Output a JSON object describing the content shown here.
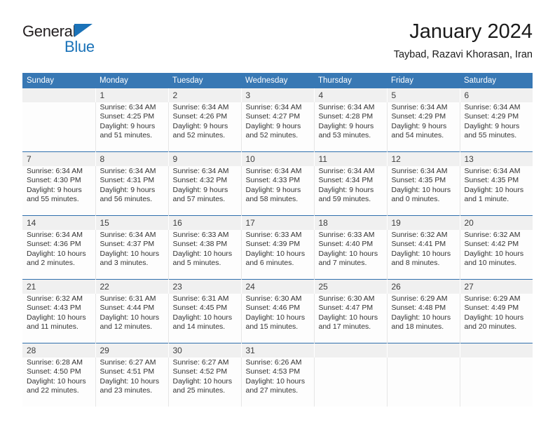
{
  "brand": {
    "name_part1": "General",
    "name_part2": "Blue"
  },
  "header": {
    "title": "January 2024",
    "subtitle": "Taybad, Razavi Khorasan, Iran"
  },
  "colors": {
    "header_blue": "#3878b4",
    "brand_blue": "#1a72b8",
    "row_separator": "#2f6fad",
    "daynum_band": "#f0f0f0"
  },
  "weekdays": [
    "Sunday",
    "Monday",
    "Tuesday",
    "Wednesday",
    "Thursday",
    "Friday",
    "Saturday"
  ],
  "weeks": [
    [
      {
        "day": "",
        "lines": []
      },
      {
        "day": "1",
        "lines": [
          "Sunrise: 6:34 AM",
          "Sunset: 4:25 PM",
          "Daylight: 9 hours",
          "and 51 minutes."
        ]
      },
      {
        "day": "2",
        "lines": [
          "Sunrise: 6:34 AM",
          "Sunset: 4:26 PM",
          "Daylight: 9 hours",
          "and 52 minutes."
        ]
      },
      {
        "day": "3",
        "lines": [
          "Sunrise: 6:34 AM",
          "Sunset: 4:27 PM",
          "Daylight: 9 hours",
          "and 52 minutes."
        ]
      },
      {
        "day": "4",
        "lines": [
          "Sunrise: 6:34 AM",
          "Sunset: 4:28 PM",
          "Daylight: 9 hours",
          "and 53 minutes."
        ]
      },
      {
        "day": "5",
        "lines": [
          "Sunrise: 6:34 AM",
          "Sunset: 4:29 PM",
          "Daylight: 9 hours",
          "and 54 minutes."
        ]
      },
      {
        "day": "6",
        "lines": [
          "Sunrise: 6:34 AM",
          "Sunset: 4:29 PM",
          "Daylight: 9 hours",
          "and 55 minutes."
        ]
      }
    ],
    [
      {
        "day": "7",
        "lines": [
          "Sunrise: 6:34 AM",
          "Sunset: 4:30 PM",
          "Daylight: 9 hours",
          "and 55 minutes."
        ]
      },
      {
        "day": "8",
        "lines": [
          "Sunrise: 6:34 AM",
          "Sunset: 4:31 PM",
          "Daylight: 9 hours",
          "and 56 minutes."
        ]
      },
      {
        "day": "9",
        "lines": [
          "Sunrise: 6:34 AM",
          "Sunset: 4:32 PM",
          "Daylight: 9 hours",
          "and 57 minutes."
        ]
      },
      {
        "day": "10",
        "lines": [
          "Sunrise: 6:34 AM",
          "Sunset: 4:33 PM",
          "Daylight: 9 hours",
          "and 58 minutes."
        ]
      },
      {
        "day": "11",
        "lines": [
          "Sunrise: 6:34 AM",
          "Sunset: 4:34 PM",
          "Daylight: 9 hours",
          "and 59 minutes."
        ]
      },
      {
        "day": "12",
        "lines": [
          "Sunrise: 6:34 AM",
          "Sunset: 4:35 PM",
          "Daylight: 10 hours",
          "and 0 minutes."
        ]
      },
      {
        "day": "13",
        "lines": [
          "Sunrise: 6:34 AM",
          "Sunset: 4:35 PM",
          "Daylight: 10 hours",
          "and 1 minute."
        ]
      }
    ],
    [
      {
        "day": "14",
        "lines": [
          "Sunrise: 6:34 AM",
          "Sunset: 4:36 PM",
          "Daylight: 10 hours",
          "and 2 minutes."
        ]
      },
      {
        "day": "15",
        "lines": [
          "Sunrise: 6:34 AM",
          "Sunset: 4:37 PM",
          "Daylight: 10 hours",
          "and 3 minutes."
        ]
      },
      {
        "day": "16",
        "lines": [
          "Sunrise: 6:33 AM",
          "Sunset: 4:38 PM",
          "Daylight: 10 hours",
          "and 5 minutes."
        ]
      },
      {
        "day": "17",
        "lines": [
          "Sunrise: 6:33 AM",
          "Sunset: 4:39 PM",
          "Daylight: 10 hours",
          "and 6 minutes."
        ]
      },
      {
        "day": "18",
        "lines": [
          "Sunrise: 6:33 AM",
          "Sunset: 4:40 PM",
          "Daylight: 10 hours",
          "and 7 minutes."
        ]
      },
      {
        "day": "19",
        "lines": [
          "Sunrise: 6:32 AM",
          "Sunset: 4:41 PM",
          "Daylight: 10 hours",
          "and 8 minutes."
        ]
      },
      {
        "day": "20",
        "lines": [
          "Sunrise: 6:32 AM",
          "Sunset: 4:42 PM",
          "Daylight: 10 hours",
          "and 10 minutes."
        ]
      }
    ],
    [
      {
        "day": "21",
        "lines": [
          "Sunrise: 6:32 AM",
          "Sunset: 4:43 PM",
          "Daylight: 10 hours",
          "and 11 minutes."
        ]
      },
      {
        "day": "22",
        "lines": [
          "Sunrise: 6:31 AM",
          "Sunset: 4:44 PM",
          "Daylight: 10 hours",
          "and 12 minutes."
        ]
      },
      {
        "day": "23",
        "lines": [
          "Sunrise: 6:31 AM",
          "Sunset: 4:45 PM",
          "Daylight: 10 hours",
          "and 14 minutes."
        ]
      },
      {
        "day": "24",
        "lines": [
          "Sunrise: 6:30 AM",
          "Sunset: 4:46 PM",
          "Daylight: 10 hours",
          "and 15 minutes."
        ]
      },
      {
        "day": "25",
        "lines": [
          "Sunrise: 6:30 AM",
          "Sunset: 4:47 PM",
          "Daylight: 10 hours",
          "and 17 minutes."
        ]
      },
      {
        "day": "26",
        "lines": [
          "Sunrise: 6:29 AM",
          "Sunset: 4:48 PM",
          "Daylight: 10 hours",
          "and 18 minutes."
        ]
      },
      {
        "day": "27",
        "lines": [
          "Sunrise: 6:29 AM",
          "Sunset: 4:49 PM",
          "Daylight: 10 hours",
          "and 20 minutes."
        ]
      }
    ],
    [
      {
        "day": "28",
        "lines": [
          "Sunrise: 6:28 AM",
          "Sunset: 4:50 PM",
          "Daylight: 10 hours",
          "and 22 minutes."
        ]
      },
      {
        "day": "29",
        "lines": [
          "Sunrise: 6:27 AM",
          "Sunset: 4:51 PM",
          "Daylight: 10 hours",
          "and 23 minutes."
        ]
      },
      {
        "day": "30",
        "lines": [
          "Sunrise: 6:27 AM",
          "Sunset: 4:52 PM",
          "Daylight: 10 hours",
          "and 25 minutes."
        ]
      },
      {
        "day": "31",
        "lines": [
          "Sunrise: 6:26 AM",
          "Sunset: 4:53 PM",
          "Daylight: 10 hours",
          "and 27 minutes."
        ]
      },
      {
        "day": "",
        "lines": []
      },
      {
        "day": "",
        "lines": []
      },
      {
        "day": "",
        "lines": []
      }
    ]
  ]
}
